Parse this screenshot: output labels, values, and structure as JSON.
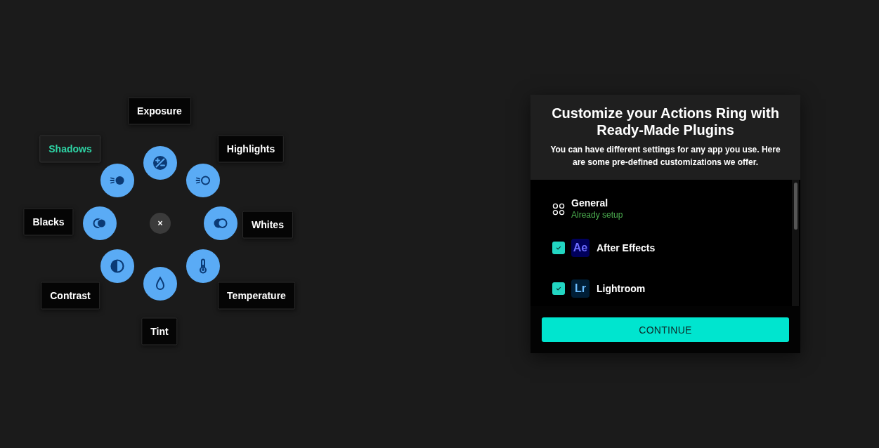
{
  "ring": {
    "close": "×",
    "items": [
      {
        "label": "Exposure",
        "selected": false
      },
      {
        "label": "Highlights",
        "selected": false
      },
      {
        "label": "Whites",
        "selected": false
      },
      {
        "label": "Temperature",
        "selected": false
      },
      {
        "label": "Tint",
        "selected": false
      },
      {
        "label": "Contrast",
        "selected": false
      },
      {
        "label": "Blacks",
        "selected": false
      },
      {
        "label": "Shadows",
        "selected": true
      }
    ]
  },
  "dialog": {
    "title": "Customize your Actions Ring with Ready-Made Plugins",
    "description": "You can have different settings for any app you use. Here are some pre-defined customizations we offer.",
    "general": {
      "name": "General",
      "status": "Already setup"
    },
    "apps": [
      {
        "name": "After Effects",
        "checked": true,
        "logo": {
          "text": "Ae",
          "color": "#00005b"
        }
      },
      {
        "name": "Lightroom",
        "checked": true,
        "logo": {
          "text": "Lr",
          "color": "#001e36"
        }
      }
    ],
    "continue_button": "CONTINUE"
  }
}
